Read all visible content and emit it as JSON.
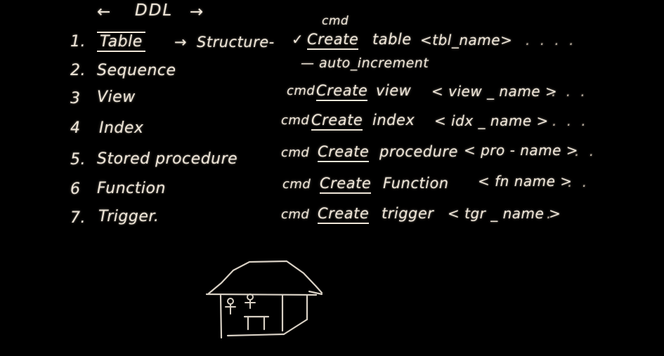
{
  "board": {
    "background_color": "#000000",
    "ink_color": "#efe6d8",
    "header": {
      "left_arrow": "←",
      "title": "DDL",
      "right_arrow": "→"
    }
  },
  "rows": [
    {
      "number": "1.",
      "term": "Table",
      "term_boxed": true,
      "mid_arrow": "→",
      "structure": "Structure-",
      "check": "✓",
      "cmd_label": "cmd",
      "cmd_prefix": "",
      "create": "Create",
      "keyword": "table",
      "placeholder": "<tbl_name>",
      "dots": ". . . .",
      "note": "— auto_increment"
    },
    {
      "number": "2.",
      "term": "Sequence",
      "term_boxed": false,
      "mid_arrow": "",
      "structure": "",
      "check": "",
      "cmd_label": "",
      "cmd_prefix": "",
      "create": "",
      "keyword": "",
      "placeholder": "",
      "dots": "",
      "note": ""
    },
    {
      "number": "3",
      "term": "View",
      "term_boxed": false,
      "mid_arrow": "",
      "structure": "",
      "check": "",
      "cmd_label": "",
      "cmd_prefix": "cmd",
      "create": "Create",
      "keyword": "view",
      "placeholder": "< view _ name >",
      "dots": ". . .",
      "note": ""
    },
    {
      "number": "4",
      "term": "Index",
      "term_boxed": false,
      "mid_arrow": "",
      "structure": "",
      "check": "",
      "cmd_label": "",
      "cmd_prefix": "cmd",
      "create": "Create",
      "keyword": "index",
      "placeholder": "< idx _ name >",
      "dots": ". . .",
      "note": ""
    },
    {
      "number": "5.",
      "term": "Stored procedure",
      "term_boxed": false,
      "mid_arrow": "",
      "structure": "",
      "check": "",
      "cmd_label": "",
      "cmd_prefix": "cmd",
      "create": "Create",
      "keyword": "procedure",
      "placeholder": "< pro - name >",
      "dots": ". .",
      "note": ""
    },
    {
      "number": "6",
      "term": "Function",
      "term_boxed": false,
      "mid_arrow": "",
      "structure": "",
      "check": "",
      "cmd_label": "",
      "cmd_prefix": "cmd",
      "create": "Create",
      "keyword": "Function",
      "placeholder": "< fn name >",
      "dots": ". .",
      "note": ""
    },
    {
      "number": "7.",
      "term": "Trigger.",
      "term_boxed": false,
      "mid_arrow": "",
      "structure": "",
      "check": "",
      "cmd_label": "",
      "cmd_prefix": "cmd",
      "create": "Create",
      "keyword": "trigger",
      "placeholder": "< tgr _ name >",
      "dots": ".",
      "note": ""
    }
  ],
  "sketch": {
    "name": "house-with-two-people-and-table",
    "description": "hand drawn house outline containing two stick figures and a table"
  }
}
